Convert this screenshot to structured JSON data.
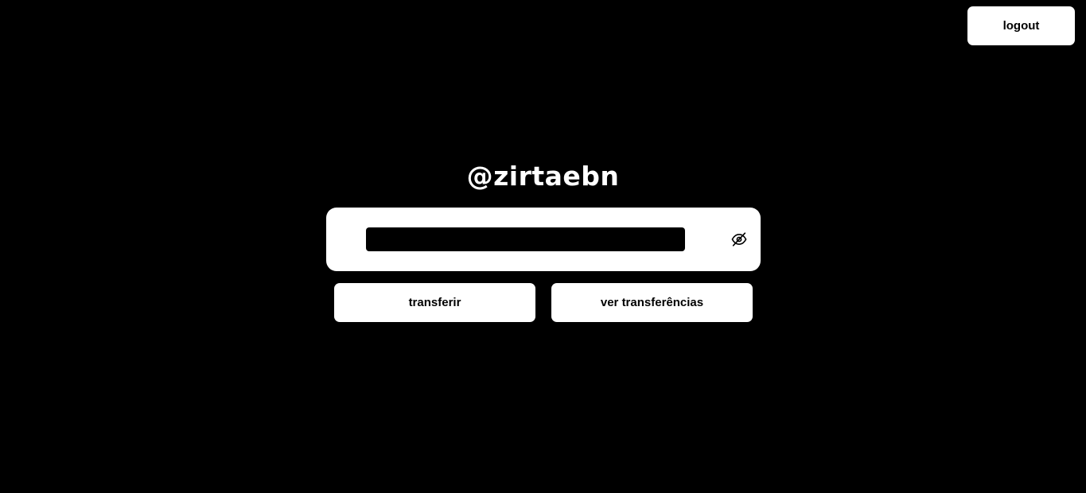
{
  "header": {
    "logout_label": "logout"
  },
  "profile": {
    "username": "@zirtaebn"
  },
  "balance": {
    "hidden": true,
    "toggle_icon": "eye-off-icon"
  },
  "actions": {
    "transfer_label": "transferir",
    "history_label": "ver transferências"
  },
  "colors": {
    "background": "#000000",
    "surface": "#ffffff",
    "text_on_surface": "#000000",
    "text_on_background": "#ffffff"
  }
}
